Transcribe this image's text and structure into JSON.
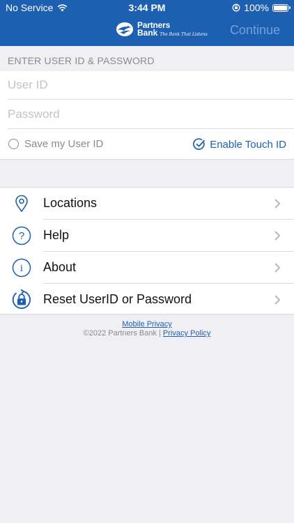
{
  "status_bar": {
    "carrier": "No Service",
    "time": "3:44 PM",
    "battery": "100%",
    "battery_level": 1.0
  },
  "header": {
    "brand_line1": "Partners",
    "brand_line2": "Bank",
    "tagline": "The Bank That Listens",
    "continue_label": "Continue"
  },
  "login": {
    "section_label": "ENTER USER ID & PASSWORD",
    "userid_placeholder": "User ID",
    "userid_value": "",
    "password_placeholder": "Password",
    "password_value": "",
    "save_user_id_label": "Save my User ID",
    "save_user_id_checked": false,
    "touch_id_label": "Enable Touch ID",
    "touch_id_enabled": true
  },
  "menu": {
    "items": [
      {
        "label": "Locations",
        "icon": "location-pin-icon"
      },
      {
        "label": "Help",
        "icon": "question-icon"
      },
      {
        "label": "About",
        "icon": "info-icon"
      },
      {
        "label": "Reset UserID or Password",
        "icon": "lock-reset-icon"
      }
    ]
  },
  "footer": {
    "mobile_privacy": "Mobile Privacy",
    "copyright": "©2022 Partners Bank | ",
    "privacy_policy": "Privacy Policy"
  },
  "colors": {
    "brand_blue": "#1d5fb0",
    "continue_disabled": "#6fa2dc",
    "background": "#efeff4"
  }
}
